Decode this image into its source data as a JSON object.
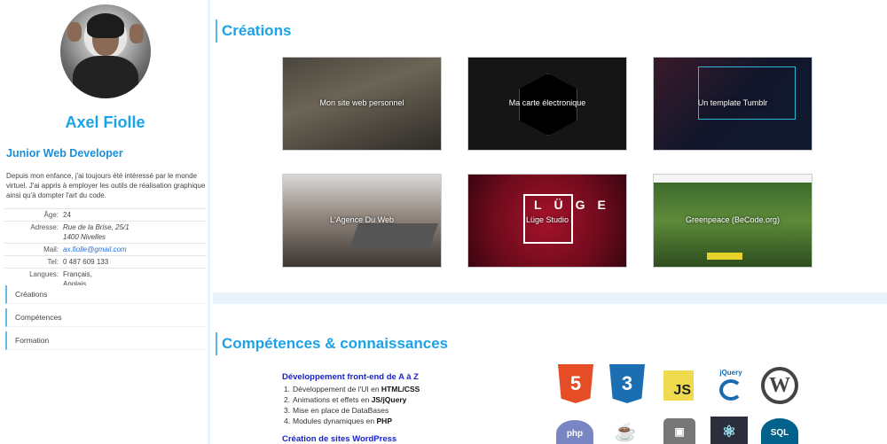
{
  "profile": {
    "name": "Axel Fiolle",
    "role": "Junior Web Developer",
    "bio": "Depuis mon enfance, j'ai toujours été intéressé par le monde virtuel. J'ai appris à employer les outils de réalisation graphique ainsi qu'à dompter l'art du code.",
    "info": {
      "age_label": "Âge:",
      "age": "24",
      "address_label": "Adresse:",
      "address_line1": "Rue de la Brise, 25/1",
      "address_line2": "1400 Nivelles",
      "mail_label": "Mail:",
      "mail": "ax.fiolle@gmail.com",
      "tel_label": "Tel:",
      "tel": "0 487 609 133",
      "lang_label": "Langues:",
      "lang1": "Français,",
      "lang2": "Anglais"
    }
  },
  "nav": [
    "Créations",
    "Compétences",
    "Formation"
  ],
  "creations": {
    "title": "Créations",
    "items": [
      {
        "label": "Mon site web personnel"
      },
      {
        "label": "Ma carte électronique"
      },
      {
        "label": "Un template Tumblr"
      },
      {
        "label": "L'Agence Du Web"
      },
      {
        "label": "Lüge Studio"
      },
      {
        "label": "Greenpeace (BeCode.org)"
      }
    ],
    "luge_letters": "LÜGE"
  },
  "competences": {
    "title": "Compétences & connaissances",
    "frontend_title": "Développement front-end de A à Z",
    "frontend_items": [
      {
        "n": "1.",
        "text": "Développement de l'UI en ",
        "bold": "HTML/CSS"
      },
      {
        "n": "2.",
        "text": "Animations et effets en ",
        "bold": "JS/jQuery"
      },
      {
        "n": "3.",
        "text": "Mise en place de DataBases",
        "bold": ""
      },
      {
        "n": "4.",
        "text": "Modules dynamiques en ",
        "bold": "PHP"
      }
    ],
    "wordpress_title": "Création de sites WordPress",
    "icons": {
      "html5": "5",
      "css3": "3",
      "js": "JS",
      "jquery": "jQuery",
      "wordpress": "W",
      "php": "php",
      "java": "☕",
      "git": "▣",
      "electron": "⚛",
      "mysql": "SQL"
    }
  }
}
